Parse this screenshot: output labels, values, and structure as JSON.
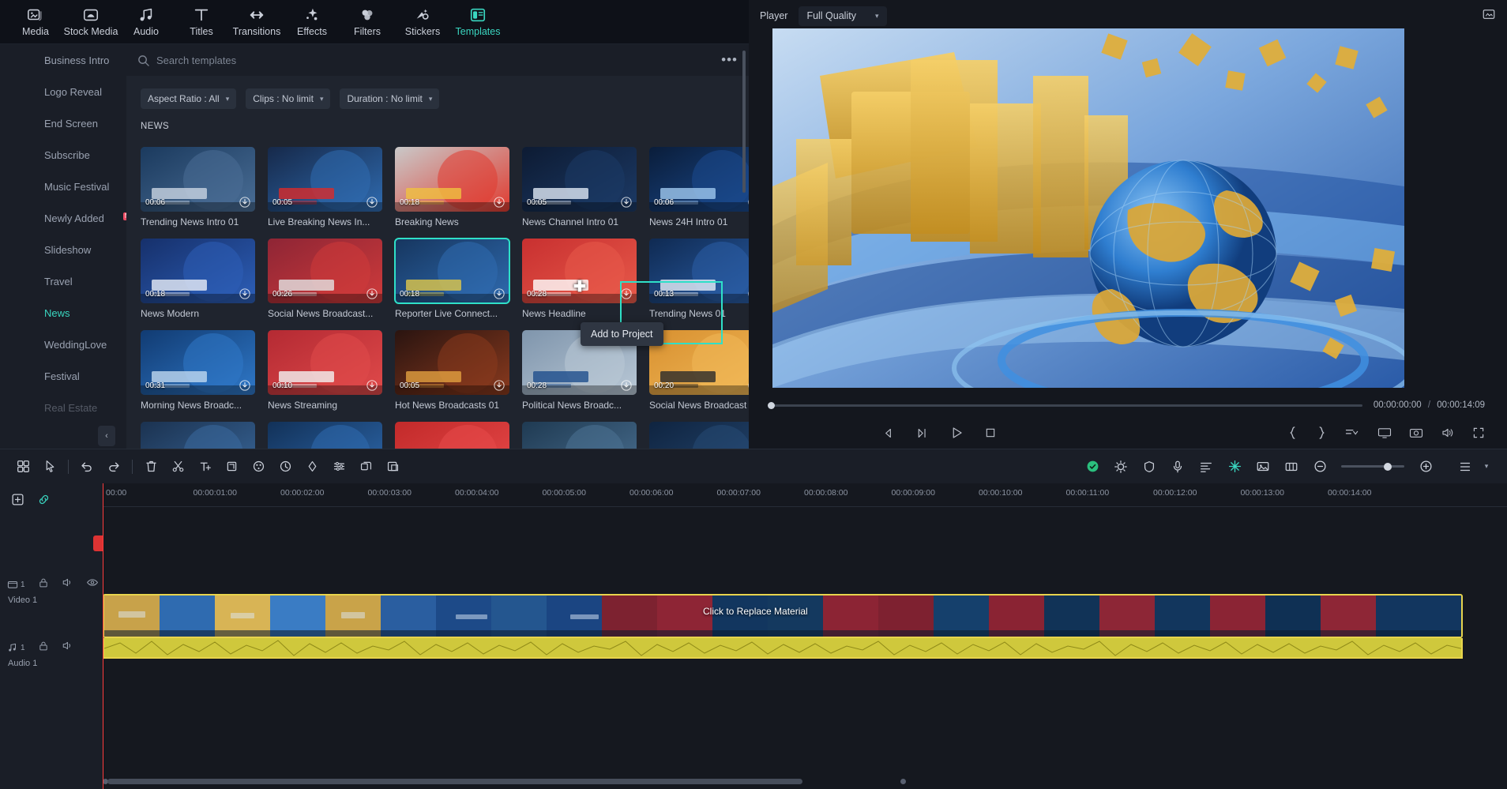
{
  "toolbar": {
    "items": [
      {
        "label": "Media",
        "icon": "media-icon",
        "active": false
      },
      {
        "label": "Stock Media",
        "icon": "stock-media-icon",
        "active": false
      },
      {
        "label": "Audio",
        "icon": "audio-icon",
        "active": false
      },
      {
        "label": "Titles",
        "icon": "titles-icon",
        "active": false
      },
      {
        "label": "Transitions",
        "icon": "transitions-icon",
        "active": false
      },
      {
        "label": "Effects",
        "icon": "effects-icon",
        "active": false
      },
      {
        "label": "Filters",
        "icon": "filters-icon",
        "active": false
      },
      {
        "label": "Stickers",
        "icon": "stickers-icon",
        "active": false
      },
      {
        "label": "Templates",
        "icon": "templates-icon",
        "active": true
      }
    ]
  },
  "sidebar": {
    "items": [
      {
        "label": "Business Intro",
        "active": false,
        "badge": ""
      },
      {
        "label": "Logo Reveal",
        "active": false,
        "badge": ""
      },
      {
        "label": "End Screen",
        "active": false,
        "badge": ""
      },
      {
        "label": "Subscribe",
        "active": false,
        "badge": ""
      },
      {
        "label": "Music Festival",
        "active": false,
        "badge": ""
      },
      {
        "label": "Newly Added",
        "active": false,
        "badge": "N"
      },
      {
        "label": "Slideshow",
        "active": false,
        "badge": ""
      },
      {
        "label": "Travel",
        "active": false,
        "badge": ""
      },
      {
        "label": "News",
        "active": true,
        "badge": ""
      },
      {
        "label": "WeddingLove",
        "active": false,
        "badge": ""
      },
      {
        "label": "Festival",
        "active": false,
        "badge": ""
      },
      {
        "label": "Real Estate",
        "active": false,
        "badge": ""
      }
    ],
    "collapse_label": "‹"
  },
  "search": {
    "placeholder": "Search templates",
    "value": "",
    "more_label": "•••"
  },
  "filters": [
    {
      "label": "Aspect Ratio : All"
    },
    {
      "label": "Clips : No limit"
    },
    {
      "label": "Duration : No limit"
    }
  ],
  "templates": {
    "section_title": "NEWS",
    "tooltip": "Add to Project",
    "items": [
      {
        "name": "Trending News Intro 01",
        "duration": "00:06",
        "selected": false,
        "style": "t1"
      },
      {
        "name": "Live Breaking News In...",
        "duration": "00:05",
        "selected": false,
        "style": "t2"
      },
      {
        "name": "Breaking News",
        "duration": "00:18",
        "selected": false,
        "style": "t3"
      },
      {
        "name": "News Channel Intro 01",
        "duration": "00:05",
        "selected": false,
        "style": "t4"
      },
      {
        "name": "News 24H Intro 01",
        "duration": "00:06",
        "selected": false,
        "style": "t5"
      },
      {
        "name": "News Modern",
        "duration": "00:18",
        "selected": false,
        "style": "t6"
      },
      {
        "name": "Social News Broadcast...",
        "duration": "00:26",
        "selected": false,
        "style": "t7"
      },
      {
        "name": "Reporter Live Connect...",
        "duration": "00:18",
        "selected": true,
        "style": "t8"
      },
      {
        "name": "News Headline",
        "duration": "00:28",
        "selected": false,
        "style": "t9"
      },
      {
        "name": "Trending News 01",
        "duration": "00:13",
        "selected": false,
        "style": "t10"
      },
      {
        "name": "Morning News Broadc...",
        "duration": "00:31",
        "selected": false,
        "style": "t11"
      },
      {
        "name": "News Streaming",
        "duration": "00:10",
        "selected": false,
        "style": "t12"
      },
      {
        "name": "Hot News Broadcasts 01",
        "duration": "00:05",
        "selected": false,
        "style": "t13"
      },
      {
        "name": "Political News Broadc...",
        "duration": "00:28",
        "selected": false,
        "style": "t14"
      },
      {
        "name": "Social News Broadcast",
        "duration": "00:20",
        "selected": false,
        "style": "t15"
      },
      {
        "name": "",
        "duration": "",
        "selected": false,
        "style": "t16"
      },
      {
        "name": "",
        "duration": "",
        "selected": false,
        "style": "t17"
      },
      {
        "name": "",
        "duration": "",
        "selected": false,
        "style": "t18"
      },
      {
        "name": "",
        "duration": "",
        "selected": false,
        "style": "t19"
      },
      {
        "name": "",
        "duration": "",
        "selected": false,
        "style": "t20"
      }
    ]
  },
  "player": {
    "title": "Player",
    "quality": "Full Quality",
    "current_time": "00:00:00:00",
    "separator": "/",
    "total_time": "00:00:14:09"
  },
  "timeline": {
    "ruler_ticks": [
      "00:00",
      "00:00:01:00",
      "00:00:02:00",
      "00:00:03:00",
      "00:00:04:00",
      "00:00:05:00",
      "00:00:06:00",
      "00:00:07:00",
      "00:00:08:00",
      "00:00:09:00",
      "00:00:10:00",
      "00:00:11:00",
      "00:00:12:00",
      "00:00:13:00",
      "00:00:14:00"
    ],
    "clip_label": "Click to Replace Material",
    "tracks": [
      {
        "name": "Video 1",
        "index": "1",
        "type": "video"
      },
      {
        "name": "Audio 1",
        "index": "1",
        "type": "audio"
      }
    ]
  },
  "colors": {
    "accent": "#3ad6c0",
    "selection": "#2fe0c8",
    "playhead": "#ff3b3b",
    "clip_border": "#e8d44d",
    "badge": "#ef4b63"
  }
}
